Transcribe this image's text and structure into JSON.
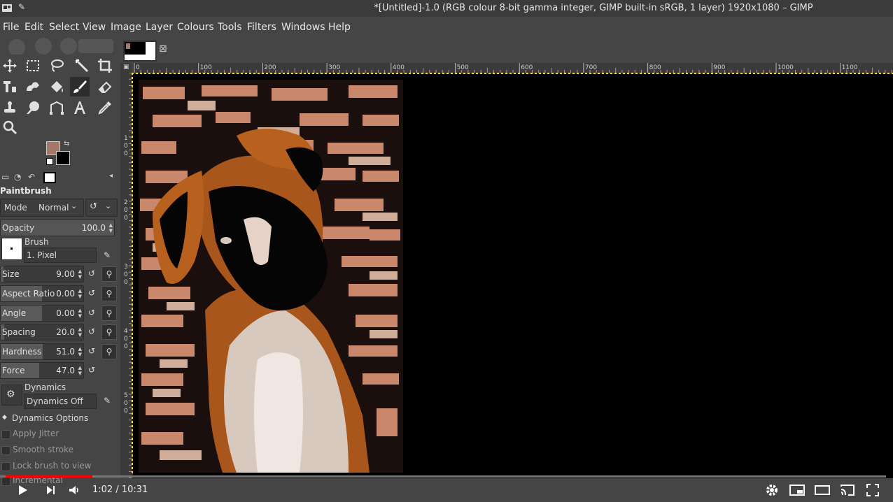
{
  "window": {
    "title": "*[Untitled]-1.0 (RGB colour 8-bit gamma integer, GIMP built-in sRGB, 1 layer) 1920x1080 – GIMP",
    "app_icon": "gimp-icon",
    "pin_icon": "pin-icon"
  },
  "menu": {
    "items": [
      "File",
      "Edit",
      "Select",
      "View",
      "Image",
      "Layer",
      "Colours",
      "Tools",
      "Filters",
      "Windows",
      "Help"
    ]
  },
  "toolbox": {
    "tools": [
      "move-tool-icon",
      "rect-select-icon",
      "lasso-icon",
      "fuzzy-select-icon",
      "crop-icon",
      "transform-icon",
      "warp-icon",
      "bucket-fill-icon",
      "paintbrush-icon",
      "eraser-icon",
      "clone-icon",
      "smudge-icon",
      "paths-icon",
      "text-icon",
      "color-picker-icon",
      "zoom-icon"
    ],
    "active_tool": "paintbrush-icon",
    "fg_color": "#a4796a",
    "bg_color": "#000000"
  },
  "tool_options": {
    "title": "Paintbrush",
    "mode_label": "Mode",
    "mode_value": "Normal",
    "opacity": {
      "label": "Opacity",
      "value": "100.0"
    },
    "brush_label": "Brush",
    "brush_value": "1. Pixel",
    "sliders": [
      {
        "label": "Size",
        "value": "9.00",
        "fill": 0.03
      },
      {
        "label": "Aspect Ratio",
        "value": "0.00",
        "fill": 0.5
      },
      {
        "label": "Angle",
        "value": "0.00",
        "fill": 0.5
      },
      {
        "label": "Spacing",
        "value": "20.0",
        "fill": 0.04
      },
      {
        "label": "Hardness",
        "value": "51.0",
        "fill": 0.51
      },
      {
        "label": "Force",
        "value": "47.0",
        "fill": 0.47
      }
    ],
    "dynamics_label": "Dynamics",
    "dynamics_value": "Dynamics Off",
    "dynamics_options": "Dynamics Options",
    "checks": [
      "Apply Jitter",
      "Smooth stroke",
      "Lock brush to view",
      "Incremental"
    ]
  },
  "rulers": {
    "top": [
      "0",
      "100",
      "200",
      "300",
      "400",
      "500",
      "600",
      "700",
      "800",
      "900",
      "1000",
      "1100"
    ],
    "left": [
      "1",
      "0",
      "0",
      "2",
      "0",
      "0",
      "3",
      "0",
      "0",
      "4",
      "0",
      "0",
      "5",
      "0",
      "0"
    ]
  },
  "video": {
    "time": "1:02 / 10:31",
    "progress": 0.098,
    "colors": {
      "played": "#ff0000"
    }
  }
}
